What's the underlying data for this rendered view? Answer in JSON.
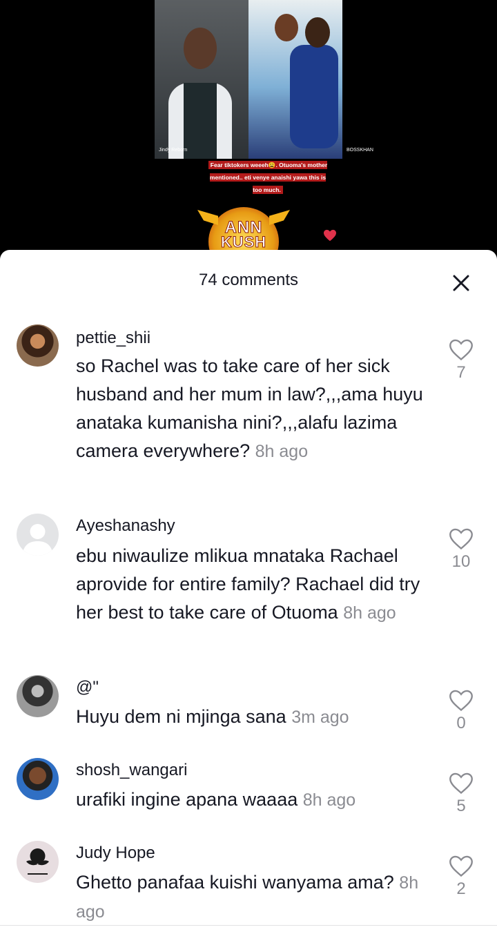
{
  "video": {
    "left_tag": "Jindy Reborn",
    "right_tag": "BOSSKHAN",
    "caption": "Fear tiktokers weeeh😩. Otuoma's mother mentioned.. eti venye anaishi yawa this is too much.",
    "logo_line1": "ANN",
    "logo_line2": "KUSH",
    "accent": "#e0324b"
  },
  "comments_panel": {
    "title": "74 comments",
    "close_icon": "close-icon"
  },
  "comments": [
    {
      "username": "pettie_shii",
      "text": "so Rachel was to take care of her sick husband and her mum in law?,,,ama huyu anataka kumanisha nini?,,,alafu lazima camera everywhere?",
      "time": "8h ago",
      "likes": "7"
    },
    {
      "username": "Ayeshanashy",
      "text": "ebu niwaulize mlikua mnataka Rachael aprovide for entire family? Rachael did try her best to take care of Otuoma",
      "time": "8h ago",
      "likes": "10"
    },
    {
      "username": "@\"",
      "text": "Huyu dem ni mjinga sana",
      "time": "3m ago",
      "likes": "0"
    },
    {
      "username": "shosh_wangari",
      "text": "urafiki ingine apana waaaa",
      "time": "8h ago",
      "likes": "5"
    },
    {
      "username": "Judy Hope",
      "text": "Ghetto panafaa kuishi wanyama ama?",
      "time": "8h ago",
      "likes": "2"
    }
  ]
}
